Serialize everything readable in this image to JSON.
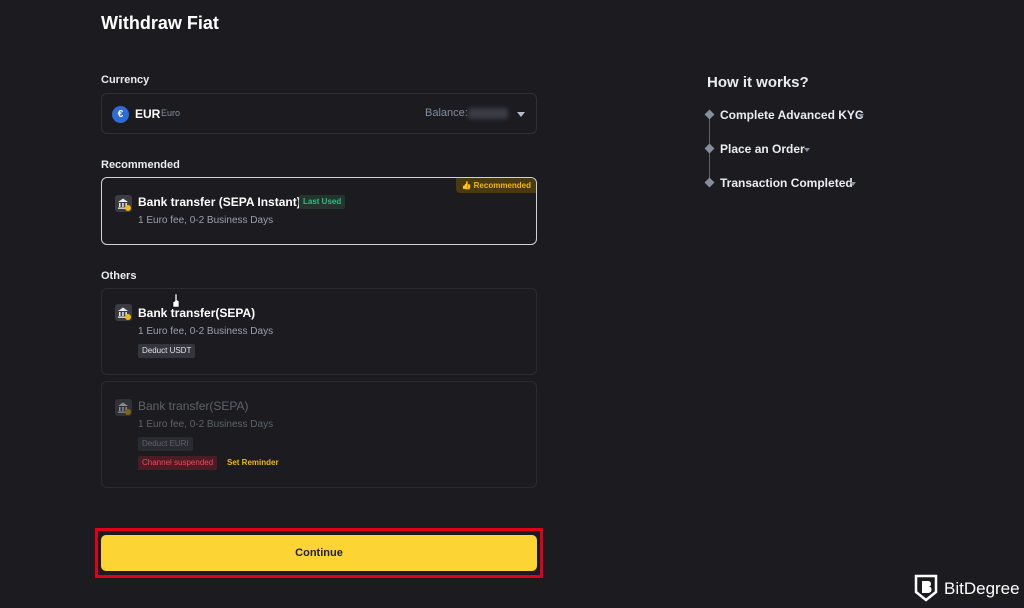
{
  "page": {
    "title": "Withdraw Fiat"
  },
  "currency": {
    "label": "Currency",
    "code": "EUR",
    "name": "Euro",
    "symbol": "€",
    "balance_label": "Balance:"
  },
  "recommended": {
    "label": "Recommended",
    "method": {
      "title": "Bank transfer (SEPA Instant)",
      "tag": "Last Used",
      "badge": "👍 Recommended",
      "description": "1 Euro fee, 0-2 Business Days"
    }
  },
  "others": {
    "label": "Others",
    "methods": [
      {
        "title": "Bank transfer(SEPA)",
        "description": "1 Euro fee, 0-2 Business Days",
        "tag": "Deduct USDT"
      },
      {
        "title": "Bank transfer(SEPA)",
        "description": "1 Euro fee, 0-2 Business Days",
        "tag": "Deduct EURI",
        "status": "Channel suspended",
        "action": "Set Reminder"
      }
    ]
  },
  "continue_label": "Continue",
  "how_it_works": {
    "title": "How it works?",
    "steps": [
      "Complete Advanced KYC",
      "Place an Order",
      "Transaction Completed"
    ]
  },
  "watermark": {
    "name": "BitDegree"
  },
  "colors": {
    "accent": "#fcd535",
    "highlight_border": "#e1001a",
    "success": "#2ebd85",
    "danger": "#f6465d"
  }
}
